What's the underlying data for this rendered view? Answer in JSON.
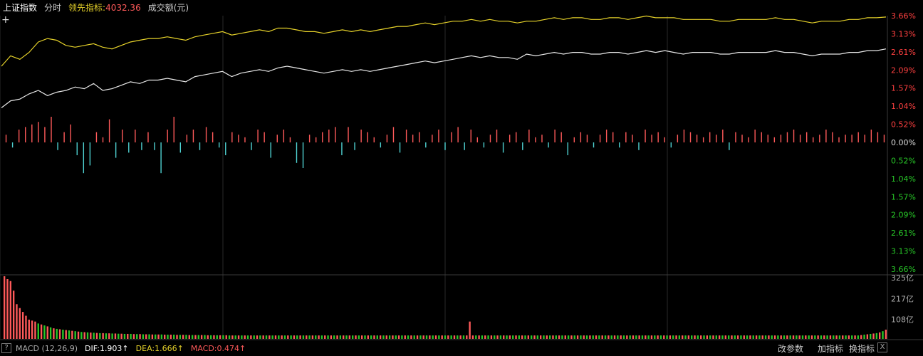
{
  "header": {
    "index_name": "上证指数",
    "mode": "分时",
    "lead_label": "领先指标:",
    "lead_value": "4032.36",
    "volume_label": "成交额(元)"
  },
  "colors": {
    "background": "#000000",
    "index_line": "#e8e8e8",
    "lead_line": "#e6d22a",
    "up": "#ff5a5a",
    "down": "#4fd2d2",
    "axis_up": "#ff4040",
    "axis_down": "#28c828",
    "grid": "#2a2a2a"
  },
  "chart_data": [
    {
      "type": "line",
      "y_axis_labels_up": [
        "3.66%",
        "3.13%",
        "2.61%",
        "2.09%",
        "1.57%",
        "1.04%",
        "0.52%"
      ],
      "y_axis_zero": "0.00%",
      "y_axis_labels_down": [
        "0.52%",
        "1.04%",
        "1.57%",
        "2.09%",
        "2.61%",
        "3.13%",
        "3.66%"
      ],
      "ylim": [
        -3.66,
        3.66
      ],
      "series": [
        {
          "values": [
            1.0,
            1.2,
            1.25,
            1.4,
            1.5,
            1.35,
            1.45,
            1.5,
            1.6,
            1.55,
            1.7,
            1.5,
            1.55,
            1.65,
            1.75,
            1.7,
            1.8,
            1.8,
            1.85,
            1.8,
            1.75,
            1.9,
            1.95,
            2.0,
            2.05,
            1.9,
            2.0,
            2.05,
            2.1,
            2.05,
            2.15,
            2.2,
            2.15,
            2.1,
            2.05,
            2.0,
            2.05,
            2.1,
            2.05,
            2.1,
            2.05,
            2.1,
            2.15,
            2.2,
            2.25,
            2.3,
            2.35,
            2.3,
            2.35,
            2.4,
            2.45,
            2.5,
            2.45,
            2.5,
            2.45,
            2.45,
            2.4,
            2.55,
            2.5,
            2.55,
            2.6,
            2.55,
            2.6,
            2.6,
            2.55,
            2.55,
            2.6,
            2.6,
            2.55,
            2.6,
            2.65,
            2.6,
            2.65,
            2.6,
            2.55,
            2.6,
            2.6,
            2.6,
            2.55,
            2.55,
            2.6,
            2.6,
            2.6,
            2.6,
            2.65,
            2.6,
            2.6,
            2.55,
            2.5,
            2.55,
            2.55,
            2.55,
            2.6,
            2.6,
            2.65,
            2.65,
            2.7
          ]
        },
        {
          "values": [
            2.2,
            2.5,
            2.4,
            2.6,
            2.9,
            3.0,
            2.95,
            2.8,
            2.75,
            2.8,
            2.85,
            2.75,
            2.7,
            2.8,
            2.9,
            2.95,
            3.0,
            3.0,
            3.05,
            3.0,
            2.95,
            3.05,
            3.1,
            3.15,
            3.2,
            3.1,
            3.15,
            3.2,
            3.25,
            3.2,
            3.3,
            3.3,
            3.25,
            3.2,
            3.2,
            3.15,
            3.2,
            3.25,
            3.2,
            3.25,
            3.2,
            3.25,
            3.3,
            3.35,
            3.35,
            3.4,
            3.45,
            3.4,
            3.45,
            3.5,
            3.5,
            3.55,
            3.5,
            3.55,
            3.5,
            3.5,
            3.45,
            3.5,
            3.5,
            3.55,
            3.6,
            3.55,
            3.6,
            3.6,
            3.55,
            3.55,
            3.6,
            3.6,
            3.55,
            3.6,
            3.65,
            3.6,
            3.6,
            3.6,
            3.55,
            3.55,
            3.55,
            3.55,
            3.5,
            3.5,
            3.55,
            3.55,
            3.55,
            3.55,
            3.6,
            3.55,
            3.55,
            3.5,
            3.45,
            3.5,
            3.5,
            3.5,
            3.55,
            3.55,
            3.6,
            3.6,
            3.62
          ]
        }
      ]
    },
    {
      "type": "bar",
      "values": [
        0.3,
        -0.2,
        0.5,
        0.6,
        0.7,
        0.8,
        0.6,
        1.0,
        -0.3,
        0.4,
        0.7,
        -0.5,
        -1.2,
        -0.9,
        0.4,
        0.2,
        0.9,
        -0.6,
        0.5,
        -0.4,
        0.5,
        -0.3,
        0.4,
        -0.3,
        -1.2,
        0.5,
        1.0,
        -0.4,
        0.3,
        0.5,
        -0.3,
        0.6,
        0.4,
        -0.2,
        -0.5,
        0.4,
        0.3,
        0.2,
        -0.3,
        0.5,
        0.4,
        -0.6,
        0.3,
        0.5,
        0.2,
        -0.8,
        -1.0,
        0.3,
        0.2,
        0.4,
        0.5,
        0.6,
        -0.5,
        0.6,
        -0.3,
        0.5,
        0.4,
        0.2,
        -0.2,
        0.3,
        0.6,
        -0.4,
        0.5,
        0.3,
        0.4,
        -0.2,
        0.3,
        0.5,
        -0.3,
        0.4,
        0.6,
        -0.3,
        0.5,
        0.2,
        -0.2,
        0.3,
        0.5,
        -0.4,
        0.3,
        0.4,
        -0.3,
        0.5,
        0.2,
        0.3,
        -0.2,
        0.5,
        0.4,
        -0.5,
        0.2,
        0.4,
        0.3,
        -0.2,
        0.3,
        0.5,
        0.4,
        -0.2,
        0.4,
        0.3,
        -0.3,
        0.5,
        0.3,
        0.4,
        0.2,
        -0.2,
        0.3,
        0.5,
        0.4,
        0.3,
        0.2,
        0.4,
        0.3,
        0.5,
        -0.3,
        0.4,
        0.3,
        0.2,
        0.5,
        0.4,
        0.3,
        0.2,
        0.3,
        0.4,
        0.5,
        0.3,
        0.4,
        0.2,
        0.3,
        0.5,
        0.4,
        0.2,
        0.3,
        0.3,
        0.4,
        0.3,
        0.5,
        0.4,
        0.3
      ]
    },
    {
      "type": "bar",
      "y_axis_labels": [
        "325亿",
        "217亿",
        "108亿"
      ],
      "ylim": [
        0,
        325
      ],
      "values": [
        325,
        310,
        300,
        250,
        180,
        160,
        140,
        120,
        100,
        95,
        90,
        80,
        75,
        70,
        65,
        60,
        55,
        52,
        50,
        48,
        46,
        44,
        42,
        40,
        38,
        36,
        35,
        34,
        33,
        32,
        31,
        30,
        30,
        29,
        29,
        28,
        28,
        27,
        27,
        26,
        26,
        26,
        25,
        25,
        25,
        24,
        24,
        24,
        23,
        23,
        23,
        23,
        22,
        22,
        22,
        22,
        21,
        21,
        21,
        21,
        20,
        20,
        20,
        20,
        20,
        20,
        19,
        19,
        19,
        19,
        19,
        19,
        19,
        18,
        18,
        18,
        18,
        18,
        18,
        18,
        18,
        18,
        18,
        18,
        18,
        18,
        18,
        18,
        18,
        18,
        18,
        18,
        18,
        18,
        18,
        18,
        18,
        18,
        18,
        18,
        18,
        18,
        18,
        18,
        18,
        18,
        18,
        18,
        18,
        18,
        18,
        18,
        18,
        18,
        18,
        18,
        18,
        18,
        18,
        18,
        18,
        18,
        18,
        18,
        18,
        18,
        18,
        18,
        18,
        18,
        18,
        18,
        18,
        18,
        18,
        18,
        18,
        18,
        18,
        18,
        18,
        18,
        18,
        18,
        18,
        18,
        18,
        18,
        18,
        18,
        18,
        90,
        18,
        18,
        18,
        18,
        18,
        18,
        18,
        18,
        18,
        18,
        18,
        18,
        18,
        18,
        18,
        18,
        18,
        18,
        18,
        18,
        18,
        18,
        18,
        18,
        18,
        18,
        18,
        18,
        18,
        18,
        18,
        18,
        18,
        18,
        18,
        18,
        18,
        18,
        18,
        18,
        18,
        18,
        18,
        18,
        18,
        18,
        18,
        18,
        18,
        18,
        18,
        18,
        18,
        18,
        18,
        18,
        18,
        18,
        18,
        18,
        18,
        18,
        18,
        18,
        18,
        18,
        18,
        18,
        18,
        18,
        18,
        18,
        18,
        18,
        18,
        18,
        18,
        18,
        18,
        18,
        18,
        18,
        18,
        18,
        18,
        18,
        18,
        18,
        18,
        18,
        18,
        18,
        18,
        18,
        18,
        18,
        18,
        18,
        18,
        18,
        18,
        18,
        18,
        18,
        18,
        18,
        18,
        18,
        18,
        18,
        18,
        18,
        18,
        18,
        18,
        18,
        18,
        18,
        18,
        18,
        18,
        18,
        18,
        18,
        18,
        18,
        20,
        22,
        24,
        26,
        28,
        30,
        34,
        40,
        48
      ],
      "colors_pattern": [
        "up",
        "down",
        "up",
        "up",
        "down",
        "up",
        "down",
        "up"
      ]
    }
  ],
  "indicator": {
    "help": "?",
    "macd_label": "MACD (12,26,9)",
    "dif": "DIF:1.903↑",
    "dea": "DEA:1.666↑",
    "macd": "MACD:0.474↑"
  },
  "toolbar": {
    "change_params": "改参数",
    "add_indicator": "加指标",
    "switch_indicator": "换指标",
    "close": "X"
  }
}
